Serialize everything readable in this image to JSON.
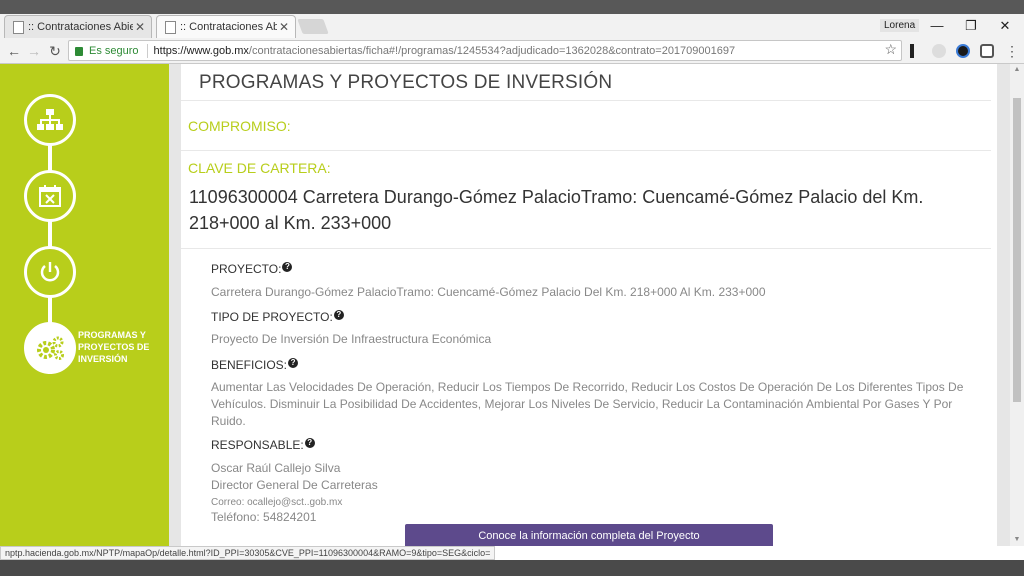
{
  "browser": {
    "tabs": [
      {
        "label": ":: Contrataciones Abiertas"
      },
      {
        "label": ":: Contrataciones Abiertas"
      }
    ],
    "user": "Lorena",
    "secure_label": "Es seguro",
    "url_host": "https://www.gob.mx",
    "url_path": "/contratacionesabiertas/ficha#!/programas/1245534?adjudicado=1362028&contrato=201709001697",
    "window_controls": [
      "—",
      "❐",
      "✕"
    ],
    "status_url": "nptp.hacienda.gob.mx/NPTP/mapaOp/detalle.html?ID_PPI=30305&CVE_PPI=11096300004&RAMO=9&tipo=SEG&ciclo="
  },
  "sidebar": {
    "steps": [
      {
        "icon": "org-chart-icon"
      },
      {
        "icon": "calendar-cancel-icon"
      },
      {
        "icon": "power-icon"
      },
      {
        "icon": "gears-icon"
      }
    ],
    "active_label": "PROGRAMAS Y PROYECTOS DE INVERSIÓN",
    "accent": "#b8ce1b"
  },
  "main": {
    "page_title": "PROGRAMAS Y PROYECTOS DE INVERSIÓN",
    "compromiso_label": "COMPROMISO:",
    "clave_label": "CLAVE DE CARTERA:",
    "clave_value": "11096300004 Carretera Durango-Gómez PalacioTramo: Cuencamé-Gómez Palacio del Km. 218+000 al Km. 233+000",
    "proyecto": {
      "label": "PROYECTO:",
      "value": "Carretera Durango-Gómez PalacioTramo: Cuencamé-Gómez Palacio Del Km. 218+000 Al Km. 233+000"
    },
    "tipo": {
      "label": "TIPO DE PROYECTO:",
      "value": "Proyecto De Inversión De Infraestructura Económica"
    },
    "beneficios": {
      "label": "BENEFICIOS:",
      "value": "Aumentar Las Velocidades De Operación, Reducir Los Tiempos De Recorrido, Reducir Los Costos De Operación De Los Diferentes Tipos De Vehículos. Disminuir La Posibilidad De Accidentes, Mejorar Los Niveles De Servicio, Reducir La Contaminación Ambiental Por Gases Y Por Ruido."
    },
    "responsable": {
      "label": "RESPONSABLE:",
      "name": "Oscar Raúl Callejo Silva",
      "position": "Director General De Carreteras",
      "email": "Correo: ocallejo@sct..gob.mx",
      "phone": "Teléfono: 54824201"
    },
    "cta_label": "Conoce la información completa del Proyecto",
    "cta_color": "#5d4a8c"
  }
}
